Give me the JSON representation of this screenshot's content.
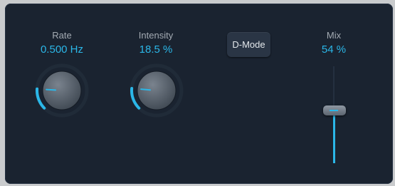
{
  "rate": {
    "label": "Rate",
    "value": "0.500 Hz",
    "fraction": 0.18
  },
  "intensity": {
    "label": "Intensity",
    "value": "18.5 %",
    "fraction": 0.185
  },
  "dmode": {
    "label": "D-Mode"
  },
  "mix": {
    "label": "Mix",
    "value": "54 %",
    "fraction": 0.54
  },
  "colors": {
    "accent": "#2bb7e8",
    "panel": "#1a2330",
    "label": "#a4abb3"
  }
}
